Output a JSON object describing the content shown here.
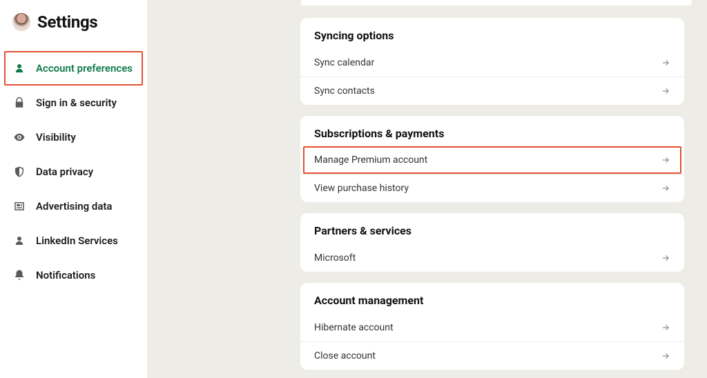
{
  "header": {
    "title": "Settings"
  },
  "sidebar": {
    "items": [
      {
        "label": "Account preferences",
        "icon": "person-badge"
      },
      {
        "label": "Sign in & security",
        "icon": "lock"
      },
      {
        "label": "Visibility",
        "icon": "eye"
      },
      {
        "label": "Data privacy",
        "icon": "shield-half"
      },
      {
        "label": "Advertising data",
        "icon": "newspaper"
      },
      {
        "label": "LinkedIn Services",
        "icon": "person"
      },
      {
        "label": "Notifications",
        "icon": "bell"
      }
    ],
    "active_index": 0
  },
  "sections": [
    {
      "title": "Syncing options",
      "rows": [
        {
          "label": "Sync calendar",
          "highlighted": false
        },
        {
          "label": "Sync contacts",
          "highlighted": false
        }
      ]
    },
    {
      "title": "Subscriptions & payments",
      "rows": [
        {
          "label": "Manage Premium account",
          "highlighted": true
        },
        {
          "label": "View purchase history",
          "highlighted": false
        }
      ]
    },
    {
      "title": "Partners & services",
      "rows": [
        {
          "label": "Microsoft",
          "highlighted": false
        }
      ]
    },
    {
      "title": "Account management",
      "rows": [
        {
          "label": "Hibernate account",
          "highlighted": false
        },
        {
          "label": "Close account",
          "highlighted": false
        }
      ]
    }
  ]
}
